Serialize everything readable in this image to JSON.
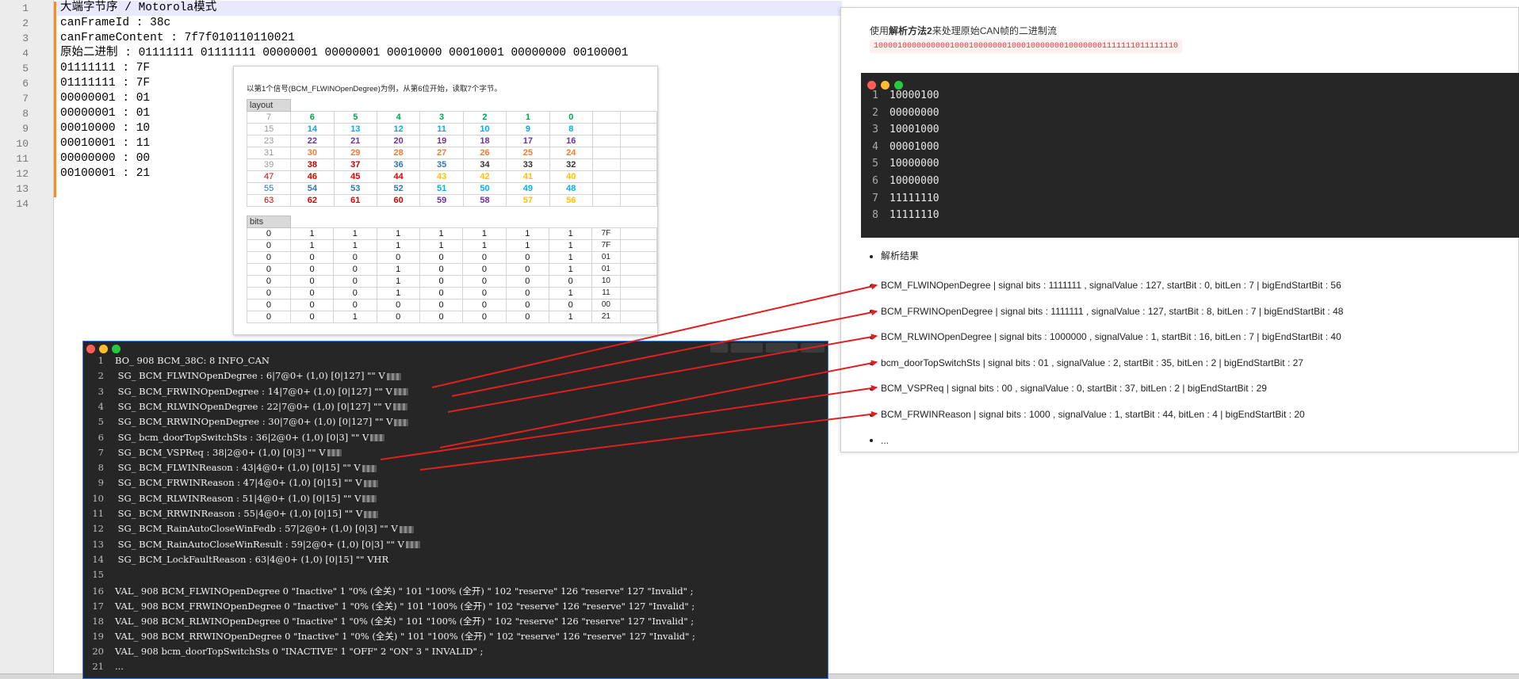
{
  "editor": {
    "line_numbers": [
      "1",
      "2",
      "3",
      "4",
      "5",
      "6",
      "7",
      "8",
      "9",
      "10",
      "11",
      "12",
      "13",
      "14"
    ],
    "lines": [
      "大端字节序 / Motorola模式",
      "canFrameId : 38c",
      "canFrameContent : 7f7f010110110021",
      "原始二进制 : 01111111 01111111 00000001 00000001 00010000 00010001 00000000 00100001",
      "01111111 : 7F",
      "01111111 : 7F",
      "00000001 : 01",
      "00000001 : 01",
      "00010000 : 10",
      "00010001 : 11",
      "00000000 : 00",
      "00100001 : 21",
      "",
      ""
    ]
  },
  "excel": {
    "title": "以第1个信号(BCM_FLWINOpenDegree)为例，从第6位开始，读取7个字节。",
    "layout_label": "layout",
    "bits_label": "bits",
    "layout_rows": [
      [
        [
          "7",
          "#999"
        ],
        [
          "6",
          "#00a651"
        ],
        [
          "5",
          "#00a651"
        ],
        [
          "4",
          "#00a651"
        ],
        [
          "3",
          "#00a651"
        ],
        [
          "2",
          "#00a651"
        ],
        [
          "1",
          "#00a651"
        ],
        [
          "0",
          "#00a651"
        ]
      ],
      [
        [
          "15",
          "#999"
        ],
        [
          "14",
          "#00aeef"
        ],
        [
          "13",
          "#00aeef"
        ],
        [
          "12",
          "#00aeef"
        ],
        [
          "11",
          "#00aeef"
        ],
        [
          "10",
          "#00aeef"
        ],
        [
          "9",
          "#00aeef"
        ],
        [
          "8",
          "#00aeef"
        ]
      ],
      [
        [
          "23",
          "#999"
        ],
        [
          "22",
          "#7030a0"
        ],
        [
          "21",
          "#7030a0"
        ],
        [
          "20",
          "#7030a0"
        ],
        [
          "19",
          "#7030a0"
        ],
        [
          "18",
          "#7030a0"
        ],
        [
          "17",
          "#7030a0"
        ],
        [
          "16",
          "#7030a0"
        ]
      ],
      [
        [
          "31",
          "#999"
        ],
        [
          "30",
          "#ed7d31"
        ],
        [
          "29",
          "#ed7d31"
        ],
        [
          "28",
          "#ed7d31"
        ],
        [
          "27",
          "#ed7d31"
        ],
        [
          "26",
          "#ed7d31"
        ],
        [
          "25",
          "#ed7d31"
        ],
        [
          "24",
          "#ed7d31"
        ]
      ],
      [
        [
          "39",
          "#999"
        ],
        [
          "38",
          "#c00000"
        ],
        [
          "37",
          "#c00000"
        ],
        [
          "36",
          "#2e75b6"
        ],
        [
          "35",
          "#2e75b6"
        ],
        [
          "34",
          "#333333"
        ],
        [
          "33",
          "#333333"
        ],
        [
          "32",
          "#333333"
        ]
      ],
      [
        [
          "47",
          "#e00000"
        ],
        [
          "46",
          "#e00000"
        ],
        [
          "45",
          "#e00000"
        ],
        [
          "44",
          "#e00000"
        ],
        [
          "43",
          "#ffc000"
        ],
        [
          "42",
          "#ffc000"
        ],
        [
          "41",
          "#ffc000"
        ],
        [
          "40",
          "#ffc000"
        ]
      ],
      [
        [
          "55",
          "#2e75b6"
        ],
        [
          "54",
          "#2e75b6"
        ],
        [
          "53",
          "#2e75b6"
        ],
        [
          "52",
          "#2e75b6"
        ],
        [
          "51",
          "#00b0f0"
        ],
        [
          "50",
          "#00b0f0"
        ],
        [
          "49",
          "#00b0f0"
        ],
        [
          "48",
          "#00b0f0"
        ]
      ],
      [
        [
          "63",
          "#e00000"
        ],
        [
          "62",
          "#e00000"
        ],
        [
          "61",
          "#e00000"
        ],
        [
          "60",
          "#e00000"
        ],
        [
          "59",
          "#7030a0"
        ],
        [
          "58",
          "#7030a0"
        ],
        [
          "57",
          "#ffc000"
        ],
        [
          "56",
          "#ffc000"
        ]
      ]
    ],
    "bits_rows": [
      {
        "bits": [
          "0",
          "1",
          "1",
          "1",
          "1",
          "1",
          "1",
          "1"
        ],
        "hex": "7F"
      },
      {
        "bits": [
          "0",
          "1",
          "1",
          "1",
          "1",
          "1",
          "1",
          "1"
        ],
        "hex": "7F"
      },
      {
        "bits": [
          "0",
          "0",
          "0",
          "0",
          "0",
          "0",
          "0",
          "1"
        ],
        "hex": "01"
      },
      {
        "bits": [
          "0",
          "0",
          "0",
          "1",
          "0",
          "0",
          "0",
          "1"
        ],
        "hex": "01"
      },
      {
        "bits": [
          "0",
          "0",
          "0",
          "1",
          "0",
          "0",
          "0",
          "0"
        ],
        "hex": "10"
      },
      {
        "bits": [
          "0",
          "0",
          "0",
          "1",
          "0",
          "0",
          "0",
          "1"
        ],
        "hex": "11"
      },
      {
        "bits": [
          "0",
          "0",
          "0",
          "0",
          "0",
          "0",
          "0",
          "0"
        ],
        "hex": "00"
      },
      {
        "bits": [
          "0",
          "0",
          "1",
          "0",
          "0",
          "0",
          "0",
          "1"
        ],
        "hex": "21"
      }
    ]
  },
  "dbc": {
    "lines": [
      "BO_ 908 BCM_38C: 8 INFO_CAN",
      " SG_ BCM_FLWINOpenDegree : 6|7@0+ (1,0) [0|127] \"\" V",
      " SG_ BCM_FRWINOpenDegree : 14|7@0+ (1,0) [0|127] \"\" V",
      " SG_ BCM_RLWINOpenDegree : 22|7@0+ (1,0) [0|127] \"\" V",
      " SG_ BCM_RRWINOpenDegree : 30|7@0+ (1,0) [0|127] \"\" V",
      " SG_ bcm_doorTopSwitchSts : 36|2@0+ (1,0) [0|3] \"\" V",
      " SG_ BCM_VSPReq : 38|2@0+ (1,0) [0|3] \"\" V",
      " SG_ BCM_FLWINReason : 43|4@0+ (1,0) [0|15] \"\" V",
      " SG_ BCM_FRWINReason : 47|4@0+ (1,0) [0|15] \"\" V",
      " SG_ BCM_RLWINReason : 51|4@0+ (1,0) [0|15] \"\" V",
      " SG_ BCM_RRWINReason : 55|4@0+ (1,0) [0|15] \"\" V",
      " SG_ BCM_RainAutoCloseWinFedb : 57|2@0+ (1,0) [0|3] \"\" V",
      " SG_ BCM_RainAutoCloseWinResult : 59|2@0+ (1,0) [0|3] \"\" V",
      " SG_ BCM_LockFaultReason : 63|4@0+ (1,0) [0|15] \"\" VHR",
      "",
      "VAL_ 908 BCM_FLWINOpenDegree 0 \"Inactive\" 1 \"0% (全关) \" 101 \"100% (全开) \" 102 \"reserve\" 126 \"reserve\" 127 \"Invalid\" ;",
      "VAL_ 908 BCM_FRWINOpenDegree 0 \"Inactive\" 1 \"0% (全关) \" 101 \"100% (全开) \" 102 \"reserve\" 126 \"reserve\" 127 \"Invalid\" ;",
      "VAL_ 908 BCM_RLWINOpenDegree 0 \"Inactive\" 1 \"0% (全关) \" 101 \"100% (全开) \" 102 \"reserve\" 126 \"reserve\" 127 \"Invalid\" ;",
      "VAL_ 908 BCM_RRWINOpenDegree 0 \"Inactive\" 1 \"0% (全关) \" 101 \"100% (全开) \" 102 \"reserve\" 126 \"reserve\" 127 \"Invalid\" ;",
      "VAL_ 908 bcm_doorTopSwitchSts 0 \"INACTIVE\" 1 \"OFF\" 2 \"ON\" 3 \" INVALID\" ;",
      "..."
    ]
  },
  "article": {
    "intro_pre": "使用",
    "intro_bold": "解析方法2",
    "intro_post": "来处理原始CAN帧的二进制流",
    "binary_stream": "1000010000000000100010000000100010000000100000001111111011111110",
    "code_lines": [
      "10000100",
      "00000000",
      "10001000",
      "00001000",
      "10000000",
      "10000000",
      "11111110",
      "11111110"
    ],
    "results_heading": "解析结果",
    "results": [
      "BCM_FLWINOpenDegree | signal bits : 1111111 , signalValue : 127, startBit : 0, bitLen : 7 | bigEndStartBit : 56",
      "BCM_FRWINOpenDegree | signal bits : 1111111 , signalValue : 127, startBit : 8, bitLen : 7 | bigEndStartBit : 48",
      "BCM_RLWINOpenDegree | signal bits : 1000000 , signalValue : 1, startBit : 16, bitLen : 7 | bigEndStartBit : 40",
      "bcm_doorTopSwitchSts | signal bits : 01 , signalValue : 2, startBit : 35, bitLen : 2 | bigEndStartBit : 27",
      "BCM_VSPReq | signal bits : 00 , signalValue : 0, startBit : 37, bitLen : 2 | bigEndStartBit : 29",
      "BCM_FRWINReason | signal bits : 1000 , signalValue : 1, startBit : 44, bitLen : 4 | bigEndStartBit : 20",
      "..."
    ]
  },
  "colors": {
    "arrow": "#e02020",
    "change_bar": "#ff8c1a",
    "terminal_bg": "#262626"
  }
}
